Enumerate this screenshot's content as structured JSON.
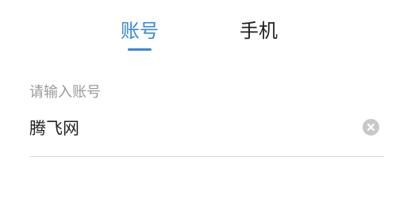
{
  "tabs": [
    {
      "label": "账号",
      "active": true
    },
    {
      "label": "手机",
      "active": false
    }
  ],
  "account_field": {
    "placeholder_label": "请输入账号",
    "value": "腾飞网"
  },
  "colors": {
    "accent": "#3a87d5",
    "text": "#222222",
    "muted": "#9a9a9a",
    "clear_icon_bg": "#c8c8c8",
    "divider": "#d6d6d6"
  },
  "icons": {
    "clear": "clear-icon"
  }
}
